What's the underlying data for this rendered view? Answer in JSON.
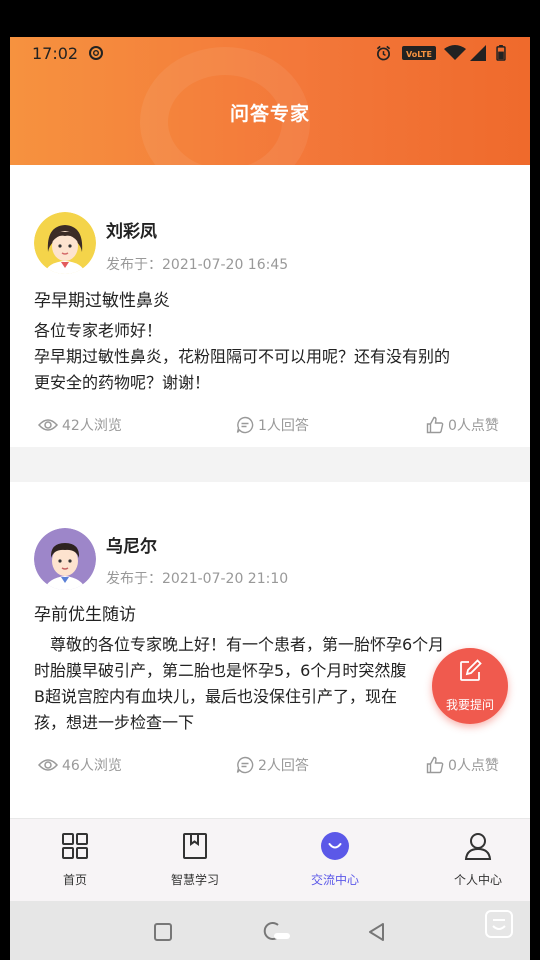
{
  "status_bar": {
    "time": "17:02",
    "volte_label": "VoLTE",
    "icons": [
      "notification-icon",
      "alarm-icon",
      "volte-icon",
      "wifi-icon",
      "signal-icon",
      "battery-icon"
    ]
  },
  "header": {
    "title": "问答专家"
  },
  "posts": [
    {
      "author": "刘彩凤",
      "published": "发布于：2021-07-20 16:45",
      "title": "孕早期过敏性鼻炎",
      "body_lines": [
        "各位专家老师好！",
        "孕早期过敏性鼻炎，花粉阻隔可不可以用呢？还有没有别的",
        "更安全的药物呢？谢谢！"
      ],
      "views": "42人浏览",
      "answers": "1人回答",
      "likes": "0人点赞",
      "avatar": "female-avatar"
    },
    {
      "author": "乌尼尔",
      "published": "发布于：2021-07-20 21:10",
      "title": "孕前优生随访",
      "body_lines": [
        "　尊敬的各位专家晚上好！有一个患者，第一胎怀孕6个月",
        "时胎膜早破引产，第二胎也是怀孕5，6个月时突然腹",
        "B超说宫腔内有血块儿，最后也没保住引产了，现在",
        "孩，想进一步检查一下"
      ],
      "views": "46人浏览",
      "answers": "2人回答",
      "likes": "0人点赞",
      "avatar": "male-avatar"
    }
  ],
  "fab": {
    "label": "我要提问"
  },
  "tabs": [
    {
      "label": "首页",
      "icon": "home-grid-icon",
      "active": false
    },
    {
      "label": "智慧学习",
      "icon": "book-icon",
      "active": false
    },
    {
      "label": "交流中心",
      "icon": "chat-icon",
      "active": true
    },
    {
      "label": "个人中心",
      "icon": "person-icon",
      "active": false
    }
  ],
  "colors": {
    "header_gradient_start": "#f6923f",
    "header_gradient_end": "#ef6a2c",
    "fab": "#f05a4e",
    "active_tab": "#5b58e8"
  }
}
